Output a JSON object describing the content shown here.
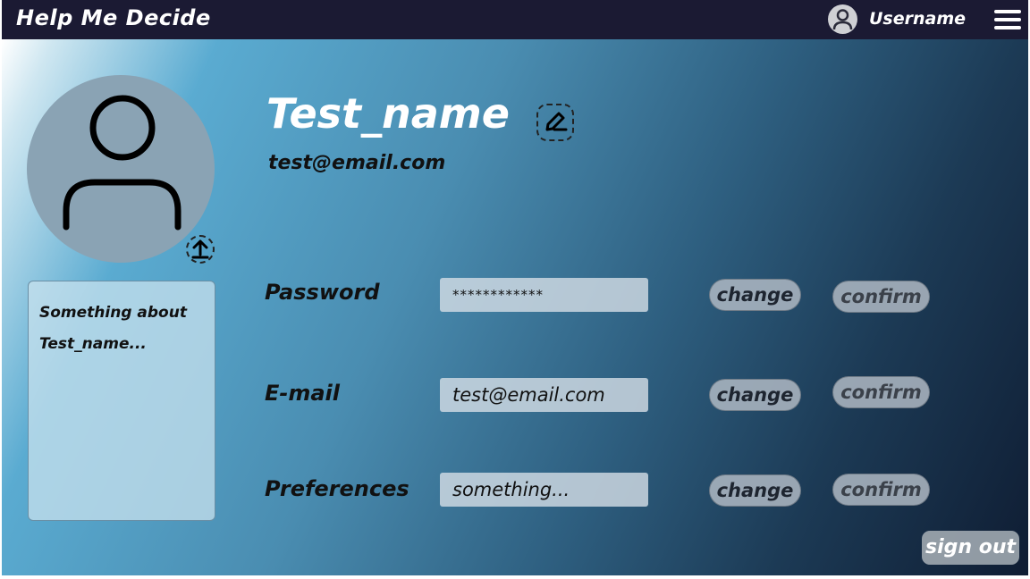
{
  "header": {
    "app_title": "Help Me Decide",
    "username": "Username"
  },
  "profile": {
    "name": "Test_name",
    "email": "test@email.com",
    "about_line1": "Something about",
    "about_line2": "Test_name..."
  },
  "settings": {
    "password": {
      "label": "Password",
      "value": "************",
      "change": "change",
      "confirm": "confirm"
    },
    "email": {
      "label": "E-mail",
      "value": "test@email.com",
      "change": "change",
      "confirm": "confirm"
    },
    "preferences": {
      "label": "Preferences",
      "value": "something...",
      "change": "change",
      "confirm": "confirm"
    }
  },
  "actions": {
    "sign_out": "sign out"
  },
  "icons": {
    "avatar": "user-icon",
    "menu": "hamburger-menu-icon",
    "upload": "upload-icon",
    "edit": "pencil-edit-icon"
  },
  "colors": {
    "header_bg": "#1b1a33",
    "gradient_mid": "#4a8db1",
    "gradient_end": "#0f1d33"
  }
}
